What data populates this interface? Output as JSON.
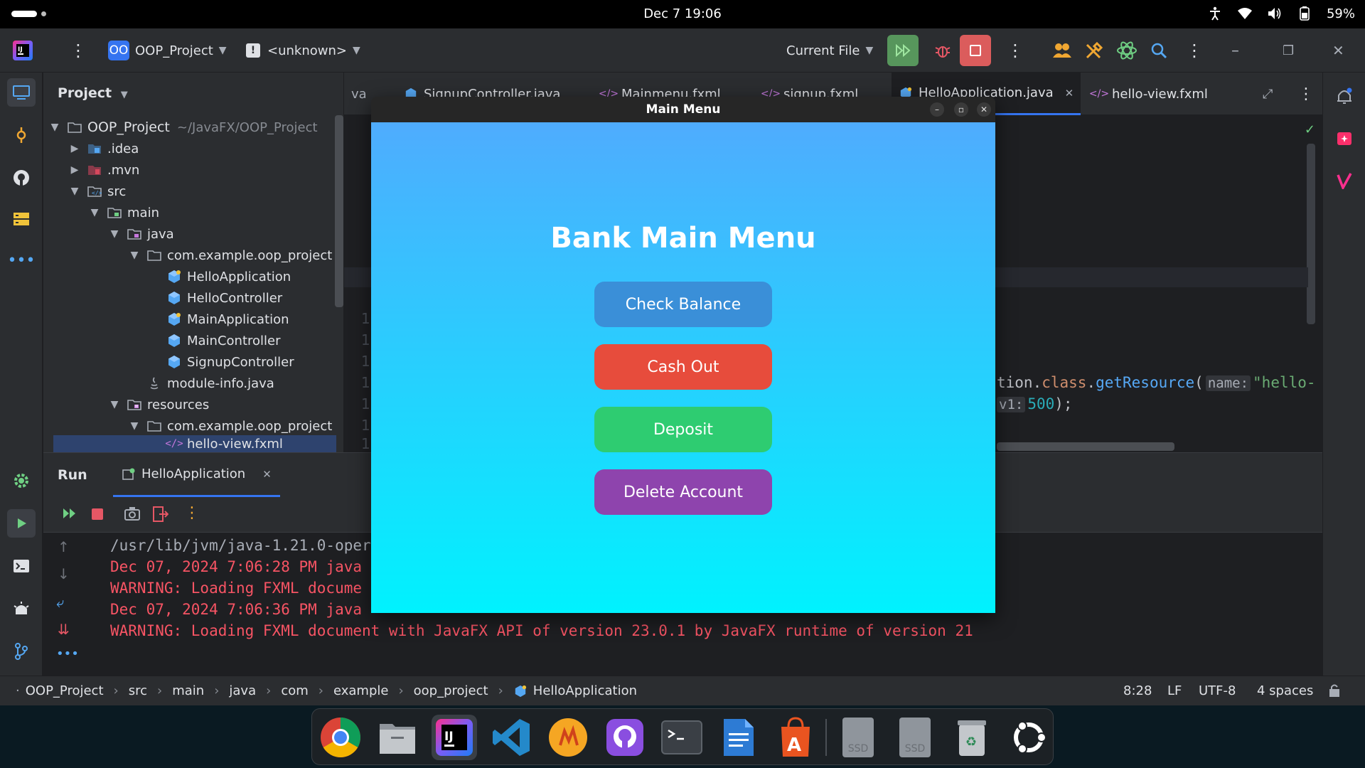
{
  "system": {
    "clock": "Dec 7  19:06",
    "battery": "59%"
  },
  "toolbar": {
    "project_badge": "OO",
    "project_name": "OOP_Project",
    "vcs_branch": "<unknown>",
    "run_config": "Current File"
  },
  "project_panel": {
    "title": "Project",
    "tree": [
      {
        "label": "OOP_Project",
        "hint": "~/JavaFX/OOP_Project",
        "icon": "folder-icon"
      },
      {
        "label": ".idea",
        "icon": "folder-icon"
      },
      {
        "label": ".mvn",
        "icon": "folder-icon"
      },
      {
        "label": "src",
        "icon": "source-folder-icon"
      },
      {
        "label": "main",
        "icon": "folder-icon"
      },
      {
        "label": "java",
        "icon": "source-folder-icon"
      },
      {
        "label": "com.example.oop_project",
        "icon": "package-icon"
      },
      {
        "label": "HelloApplication",
        "icon": "class-icon"
      },
      {
        "label": "HelloController",
        "icon": "class-icon"
      },
      {
        "label": "MainApplication",
        "icon": "class-icon"
      },
      {
        "label": "MainController",
        "icon": "class-icon"
      },
      {
        "label": "SignupController",
        "icon": "class-icon"
      },
      {
        "label": "module-info.java",
        "icon": "java-file-icon"
      },
      {
        "label": "resources",
        "icon": "resources-folder-icon"
      },
      {
        "label": "com.example.oop_project",
        "icon": "package-icon"
      },
      {
        "label": "hello-view.fxml",
        "icon": "fxml-file-icon"
      }
    ]
  },
  "editor": {
    "tabs": [
      "va",
      "SignupController.java",
      "Mainmenu.fxml",
      "signup.fxml",
      "HelloApplication.java",
      "hello-view.fxml"
    ],
    "code": {
      "line1_a": "tion.",
      "line1_b": "class",
      "line1_c": ".",
      "line1_d": "getResource",
      "line1_e": "(",
      "line1_hint": "name:",
      "line1_str": "\"hello-",
      "line2_hint": "v1:",
      "line2_num": "500",
      "line2_end": ");"
    },
    "gutter": [
      "1",
      "1",
      "1",
      "1",
      "1",
      "1",
      "1"
    ]
  },
  "run_panel": {
    "title": "Run",
    "tab_label": "HelloApplication",
    "console": [
      "/usr/lib/jvm/java-1.21.0-oper",
      "Dec 07, 2024 7:06:28 PM java",
      "WARNING: Loading FXML docume",
      "Dec 07, 2024 7:06:36 PM java",
      "WARNING: Loading FXML document with JavaFX API of version 23.0.1 by JavaFX runtime of version 21"
    ]
  },
  "statusbar": {
    "breadcrumbs": [
      "OOP_Project",
      "src",
      "main",
      "java",
      "com",
      "example",
      "oop_project",
      "HelloApplication"
    ],
    "position": "8:28",
    "line_ending": "LF",
    "encoding": "UTF-8",
    "indent": "4 spaces"
  },
  "fx_window": {
    "title": "Main Menu",
    "heading": "Bank Main Menu",
    "buttons": [
      {
        "label": "Check Balance",
        "color": "#3a8fd8"
      },
      {
        "label": "Cash Out",
        "color": "#e74c3c"
      },
      {
        "label": "Deposit",
        "color": "#2ecc71"
      },
      {
        "label": "Delete Account",
        "color": "#8e44ad"
      }
    ],
    "gradient_top": "#4facfe",
    "gradient_bottom": "#00f2fe"
  },
  "dock": {
    "apps": [
      "chrome-icon",
      "files-icon",
      "intellij-icon",
      "vscode-icon",
      "app-icon",
      "github-desktop-icon",
      "terminal-icon",
      "text-editor-icon",
      "app-center-icon",
      "ssd-drive-icon",
      "ssd-drive-icon",
      "trash-icon",
      "ubuntu-icon"
    ],
    "ssd_label": "SSD"
  }
}
